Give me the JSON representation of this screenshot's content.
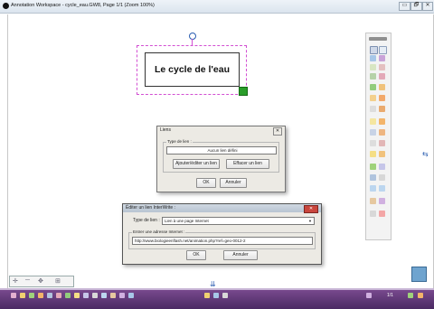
{
  "window": {
    "title": "Annotation Workspace - cycle_eau.GW8, Page 1/1  (Zoom 100%)",
    "minimize": "▭",
    "maximize": "🗗",
    "close": "✕"
  },
  "canvas": {
    "title_text": "Le cycle de l'eau"
  },
  "liens_dialog": {
    "title": "Liens",
    "close": "✕",
    "group_label": "Type de lien :",
    "empty_text": "Aucun lien défini",
    "add_button": "Ajouter/éditer un lien",
    "delete_button": "Effacer un lien",
    "ok": "OK",
    "cancel": "Annuler"
  },
  "edit_dialog": {
    "title": "Éditer un lien InterWrite :",
    "close": "✕",
    "type_label": "Type de lien :",
    "type_value": "Lien à une page Internet",
    "address_label": "Entrer une adresse Internet :",
    "address_value": "http://www.biologieenflash.net/animation.php?ref=geo-0012-2",
    "ok": "OK",
    "cancel": "Annuler"
  },
  "bottom": {
    "page_indicator": "1/1"
  },
  "colors": {
    "accent_purple": "#5a3472",
    "selection": "#d24fd2",
    "handle_green": "#2a9d2a"
  }
}
